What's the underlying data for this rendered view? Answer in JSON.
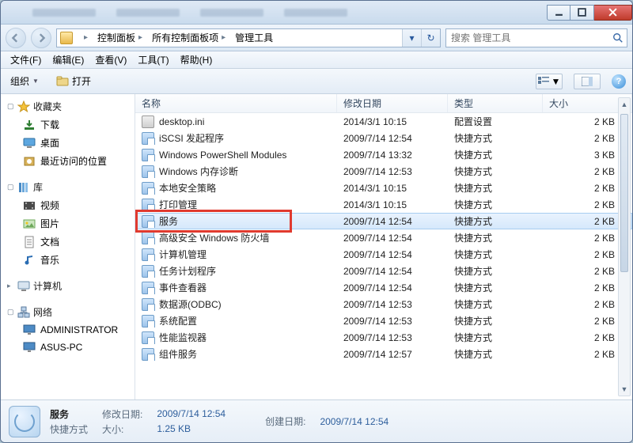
{
  "sys": {
    "min": "",
    "max": "",
    "close": ""
  },
  "breadcrumb": {
    "root": "",
    "items": [
      "控制面板",
      "所有控制面板项",
      "管理工具"
    ]
  },
  "search": {
    "placeholder": "搜索 管理工具"
  },
  "menubar": [
    "文件(F)",
    "编辑(E)",
    "查看(V)",
    "工具(T)",
    "帮助(H)"
  ],
  "cmdbar": {
    "organize": "组织",
    "open": "打开"
  },
  "columns": {
    "name": "名称",
    "date": "修改日期",
    "type": "类型",
    "size": "大小"
  },
  "sidebar": {
    "fav": {
      "label": "收藏夹",
      "items": [
        "下载",
        "桌面",
        "最近访问的位置"
      ]
    },
    "lib": {
      "label": "库",
      "items": [
        "视频",
        "图片",
        "文档",
        "音乐"
      ]
    },
    "pc": {
      "label": "计算机"
    },
    "net": {
      "label": "网络",
      "items": [
        "ADMINISTRATOR",
        "ASUS-PC"
      ]
    }
  },
  "files": [
    {
      "name": "desktop.ini",
      "date": "2014/3/1 10:15",
      "type": "配置设置",
      "size": "2 KB",
      "k": "ini"
    },
    {
      "name": "iSCSI 发起程序",
      "date": "2009/7/14 12:54",
      "type": "快捷方式",
      "size": "2 KB",
      "k": "lnk"
    },
    {
      "name": "Windows PowerShell Modules",
      "date": "2009/7/14 13:32",
      "type": "快捷方式",
      "size": "3 KB",
      "k": "lnk"
    },
    {
      "name": "Windows 内存诊断",
      "date": "2009/7/14 12:53",
      "type": "快捷方式",
      "size": "2 KB",
      "k": "lnk"
    },
    {
      "name": "本地安全策略",
      "date": "2014/3/1 10:15",
      "type": "快捷方式",
      "size": "2 KB",
      "k": "lnk"
    },
    {
      "name": "打印管理",
      "date": "2014/3/1 10:15",
      "type": "快捷方式",
      "size": "2 KB",
      "k": "lnk"
    },
    {
      "name": "服务",
      "date": "2009/7/14 12:54",
      "type": "快捷方式",
      "size": "2 KB",
      "k": "lnk",
      "sel": true,
      "hl": true
    },
    {
      "name": "高级安全 Windows 防火墙",
      "date": "2009/7/14 12:54",
      "type": "快捷方式",
      "size": "2 KB",
      "k": "lnk"
    },
    {
      "name": "计算机管理",
      "date": "2009/7/14 12:54",
      "type": "快捷方式",
      "size": "2 KB",
      "k": "lnk"
    },
    {
      "name": "任务计划程序",
      "date": "2009/7/14 12:54",
      "type": "快捷方式",
      "size": "2 KB",
      "k": "lnk"
    },
    {
      "name": "事件查看器",
      "date": "2009/7/14 12:54",
      "type": "快捷方式",
      "size": "2 KB",
      "k": "lnk"
    },
    {
      "name": "数据源(ODBC)",
      "date": "2009/7/14 12:53",
      "type": "快捷方式",
      "size": "2 KB",
      "k": "lnk"
    },
    {
      "name": "系统配置",
      "date": "2009/7/14 12:53",
      "type": "快捷方式",
      "size": "2 KB",
      "k": "lnk"
    },
    {
      "name": "性能监视器",
      "date": "2009/7/14 12:53",
      "type": "快捷方式",
      "size": "2 KB",
      "k": "lnk"
    },
    {
      "name": "组件服务",
      "date": "2009/7/14 12:57",
      "type": "快捷方式",
      "size": "2 KB",
      "k": "lnk"
    }
  ],
  "details": {
    "title": "服务",
    "type": "快捷方式",
    "mod_k": "修改日期:",
    "mod_v": "2009/7/14 12:54",
    "crt_k": "创建日期:",
    "crt_v": "2009/7/14 12:54",
    "size_k": "大小:",
    "size_v": "1.25 KB"
  }
}
